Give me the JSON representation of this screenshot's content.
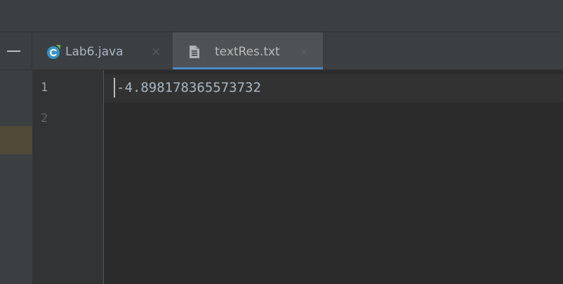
{
  "tabs": [
    {
      "label": "Lab6.java",
      "icon": "java-class-icon",
      "active": false,
      "close_symbol": "×"
    },
    {
      "label": "textRes.txt",
      "icon": "text-file-icon",
      "active": true,
      "close_symbol": "×"
    }
  ],
  "editor": {
    "line_numbers": [
      "1",
      "2"
    ],
    "lines": [
      "-4.898178365573732",
      ""
    ]
  },
  "colors": {
    "accent": "#4a88c7",
    "background": "#2b2b2b",
    "text": "#a9b7c6"
  }
}
